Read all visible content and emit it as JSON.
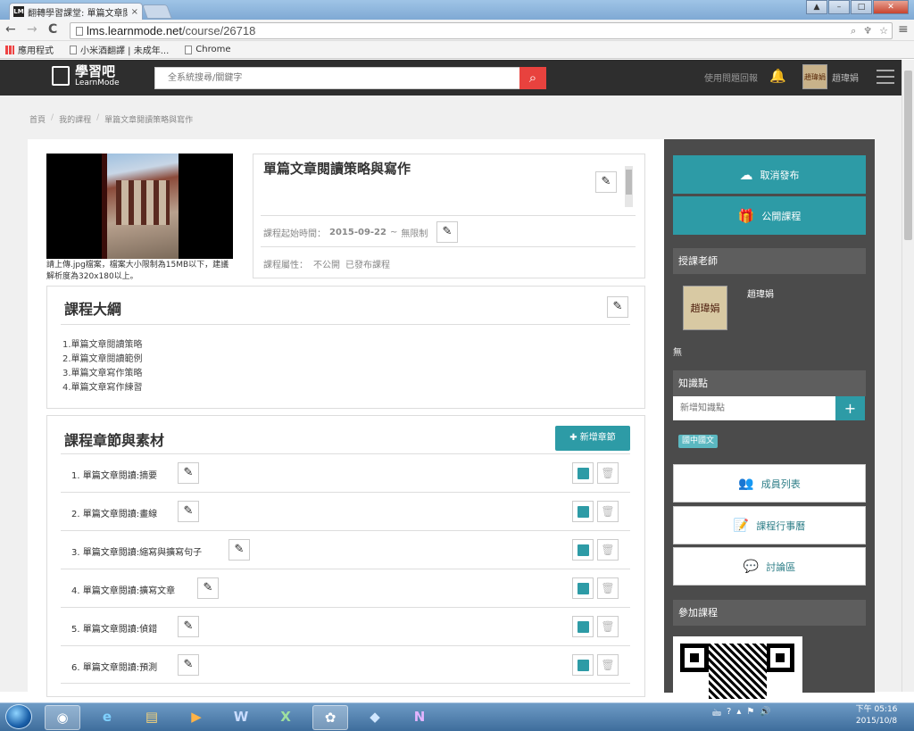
{
  "browser": {
    "tab_title": "翻轉學習課堂: 單篇文章閱",
    "tab_close": "×",
    "url_host": "lms.learnmode.net",
    "url_path": "/course/26718",
    "back": "←",
    "forward": "→",
    "reload": "C",
    "window_buttons": [
      "▲",
      "–",
      "□",
      "✕"
    ],
    "bookmarks": [
      "應用程式",
      "小米酒翻譯 | 未成年...",
      "Chrome"
    ]
  },
  "site": {
    "logo_title": "學習吧",
    "logo_sub": "LearnMode",
    "search_placeholder": "全系統搜尋/關鍵字",
    "feedback": "使用問題回報",
    "user_name": "趙瑋娟",
    "user_avatar_text": "趙瑋娟"
  },
  "breadcrumb": [
    "首頁",
    "我的課程",
    "單篇文章閱讀策略與寫作"
  ],
  "course": {
    "cover_hint": "請上傳.jpg檔案，檔案大小限制為15MB以下，建議解析度為320x180以上。",
    "title": "單篇文章閱讀策略與寫作",
    "start_label": "課程起始時間：",
    "start_value": "2015-09-22",
    "start_sep": "~",
    "end_value": "無限制",
    "property_label": "課程屬性：",
    "property_visibility": "不公開",
    "property_status": "已發布課程"
  },
  "outline": {
    "title": "課程大綱",
    "items": [
      "1.單篇文章閱讀策略",
      "2.單篇文章閱讀範例",
      "3.單篇文章寫作策略",
      "4.單篇文章寫作練習"
    ]
  },
  "chapters": {
    "title": "課程章節與素材",
    "add_label": "新增章節",
    "items": [
      "1. 單篇文章閱讀:摘要",
      "2. 單篇文章閱讀:畫線",
      "3. 單篇文章閱讀:縮寫與擴寫句子",
      "4. 單篇文章閱讀:擴寫文章",
      "5. 單篇文章閱讀:偵錯",
      "6. 單篇文章閱讀:預測"
    ]
  },
  "sidebar": {
    "unpublish": "取消發布",
    "public_course": "公開課程",
    "teacher_head": "授課老師",
    "teacher_name": "趙瑋娟",
    "teacher_avatar_text": "趙瑋娟",
    "teacher_note": "無",
    "knowledge_head": "知識點",
    "knowledge_placeholder": "新增知識點",
    "knowledge_add": "+",
    "knowledge_tag": "國中國文",
    "members": "成員列表",
    "calendar": "課程行事曆",
    "discussion": "討論區",
    "join_head": "參加課程"
  },
  "taskbar": {
    "tray_icons": [
      "🖮",
      "?",
      "▴",
      "⚑",
      "🔊"
    ],
    "time_prefix": "下午",
    "time": "05:16",
    "date": "2015/10/8"
  },
  "colors": {
    "accent_teal": "#2d9ba6",
    "header_dark": "#2e2e2e",
    "search_red": "#e8423e",
    "sidebar_dark": "#4b4b4b"
  }
}
